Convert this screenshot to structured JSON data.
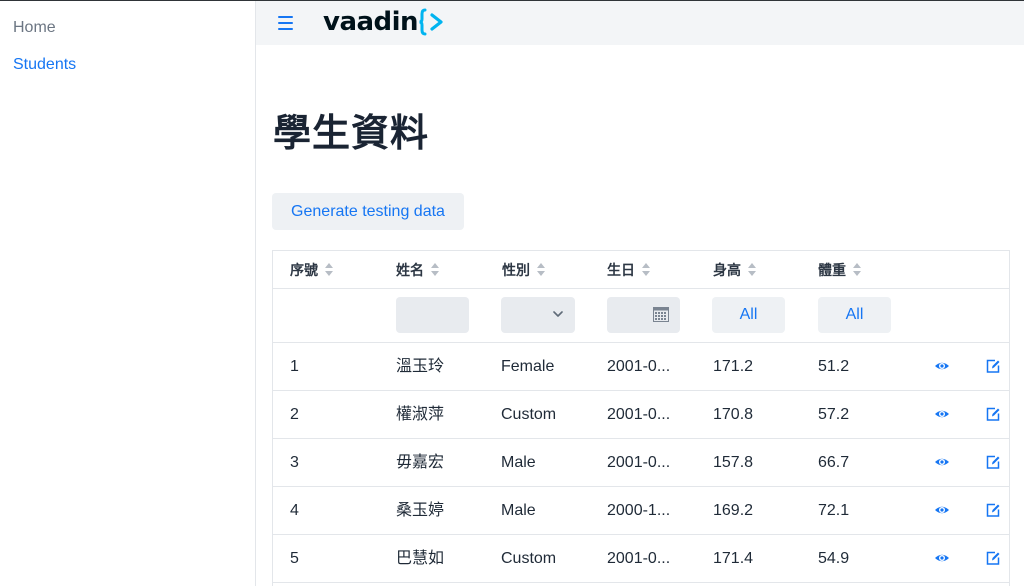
{
  "drawer": {
    "items": [
      {
        "label": "Home"
      },
      {
        "label": "Students"
      }
    ]
  },
  "navbar": {
    "logo_text": "vaadin"
  },
  "page": {
    "title": "學生資料",
    "generate_button": "Generate testing data"
  },
  "grid": {
    "columns": [
      "序號",
      "姓名",
      "性別",
      "生日",
      "身高",
      "體重"
    ],
    "filters": {
      "height_all": "All",
      "weight_all": "All"
    },
    "rows": [
      {
        "id": "1",
        "name": "溫玉玲",
        "gender": "Female",
        "birthday": "2001-0...",
        "height": "171.2",
        "weight": "51.2"
      },
      {
        "id": "2",
        "name": "權淑萍",
        "gender": "Custom",
        "birthday": "2001-0...",
        "height": "170.8",
        "weight": "57.2"
      },
      {
        "id": "3",
        "name": "毋嘉宏",
        "gender": "Male",
        "birthday": "2001-0...",
        "height": "157.8",
        "weight": "66.7"
      },
      {
        "id": "4",
        "name": "桑玉婷",
        "gender": "Male",
        "birthday": "2000-1...",
        "height": "169.2",
        "weight": "72.1"
      },
      {
        "id": "5",
        "name": "巴慧如",
        "gender": "Custom",
        "birthday": "2001-0...",
        "height": "171.4",
        "weight": "54.9"
      }
    ]
  },
  "icons": {
    "view": "eye-icon",
    "edit": "edit-icon",
    "menu": "hamburger-menu-icon",
    "calendar": "calendar-icon",
    "dropdown": "chevron-down-icon"
  },
  "colors": {
    "accent": "#1676f3",
    "text": "#1a2433",
    "muted": "#6c7683",
    "navbar_bg": "#f3f5f7",
    "field_bg": "#e8ebef",
    "border": "#e3e6ea"
  }
}
